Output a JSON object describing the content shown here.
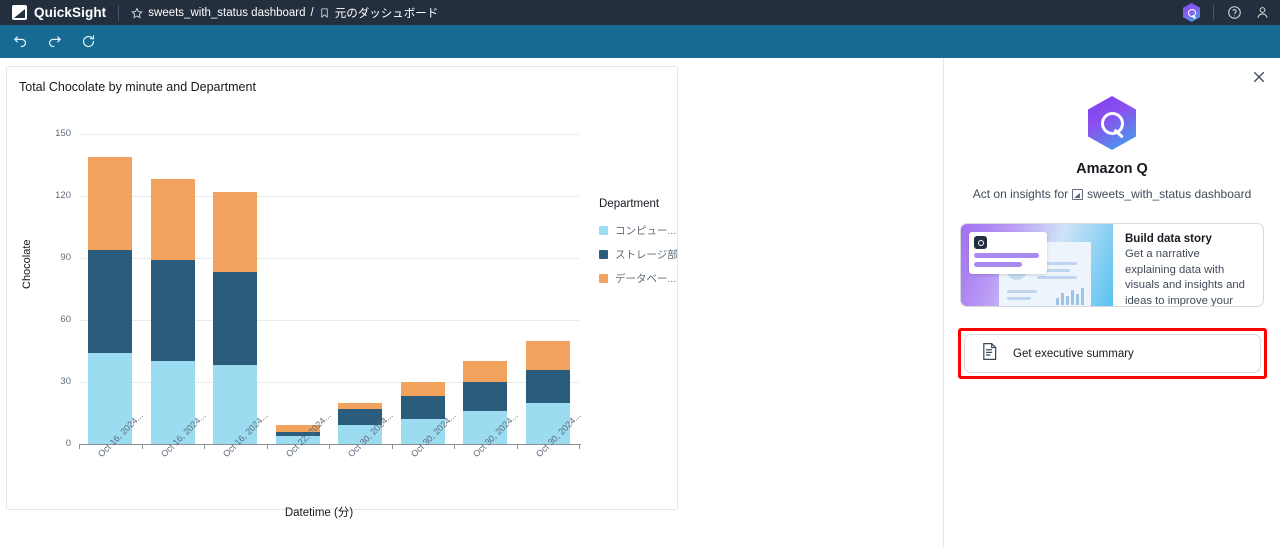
{
  "header": {
    "brand": "QuickSight",
    "star_icon": "star-icon",
    "breadcrumb_dashboard": "sweets_with_status dashboard",
    "breadcrumb_separator": "/",
    "bookmark_icon": "bookmark-icon",
    "breadcrumb_sheet": "元のダッシュボード",
    "q_icon": "amazon-q-icon",
    "help_icon": "help-icon",
    "user_icon": "user-icon"
  },
  "toolbar": {
    "undo_icon": "undo-icon",
    "redo_icon": "redo-icon",
    "reset_icon": "reset-icon"
  },
  "chart_data": {
    "type": "bar",
    "title": "Total Chocolate by minute and Department",
    "xlabel": "Datetime (分)",
    "ylabel": "Chocolate",
    "ylim": [
      0,
      150
    ],
    "yticks": [
      0,
      30,
      60,
      90,
      120,
      150
    ],
    "grid": true,
    "stacked": true,
    "legend_title": "Department",
    "legend_position": "right",
    "categories": [
      "Oct 16, 2024...",
      "Oct 16, 2024...",
      "Oct 16, 2024...",
      "Oct 22, 2024...",
      "Oct 30, 2024...",
      "Oct 30, 2024...",
      "Oct 30, 2024...",
      "Oct 30, 2024..."
    ],
    "series": [
      {
        "name": "コンピュー...",
        "color": "#9bdcf0",
        "values": [
          44,
          40,
          38,
          4,
          9,
          12,
          16,
          20
        ]
      },
      {
        "name": "ストレージ部",
        "color": "#2b5c7b",
        "values": [
          50,
          49,
          45,
          2,
          8,
          11,
          14,
          16
        ]
      },
      {
        "name": "データベー...",
        "color": "#f2a35e",
        "values": [
          45,
          39,
          39,
          3,
          3,
          7,
          10,
          14
        ]
      }
    ]
  },
  "q_panel": {
    "close_icon": "close-icon",
    "logo_icon": "amazon-q-logo-icon",
    "title": "Amazon Q",
    "subtitle_prefix": "Act on insights for",
    "subtitle_dashboard": "sweets_with_status dashboard",
    "dashboard_icon": "dashboard-icon",
    "cards": {
      "build_story": {
        "heading": "Build data story",
        "description": "Get a narrative explaining data with visuals and insights and ideas to improve your business",
        "thumbnail_icon": "data-story-thumbnail"
      },
      "executive_summary": {
        "label": "Get executive summary",
        "icon": "document-icon",
        "highlight_color": "#ff0000"
      }
    }
  }
}
